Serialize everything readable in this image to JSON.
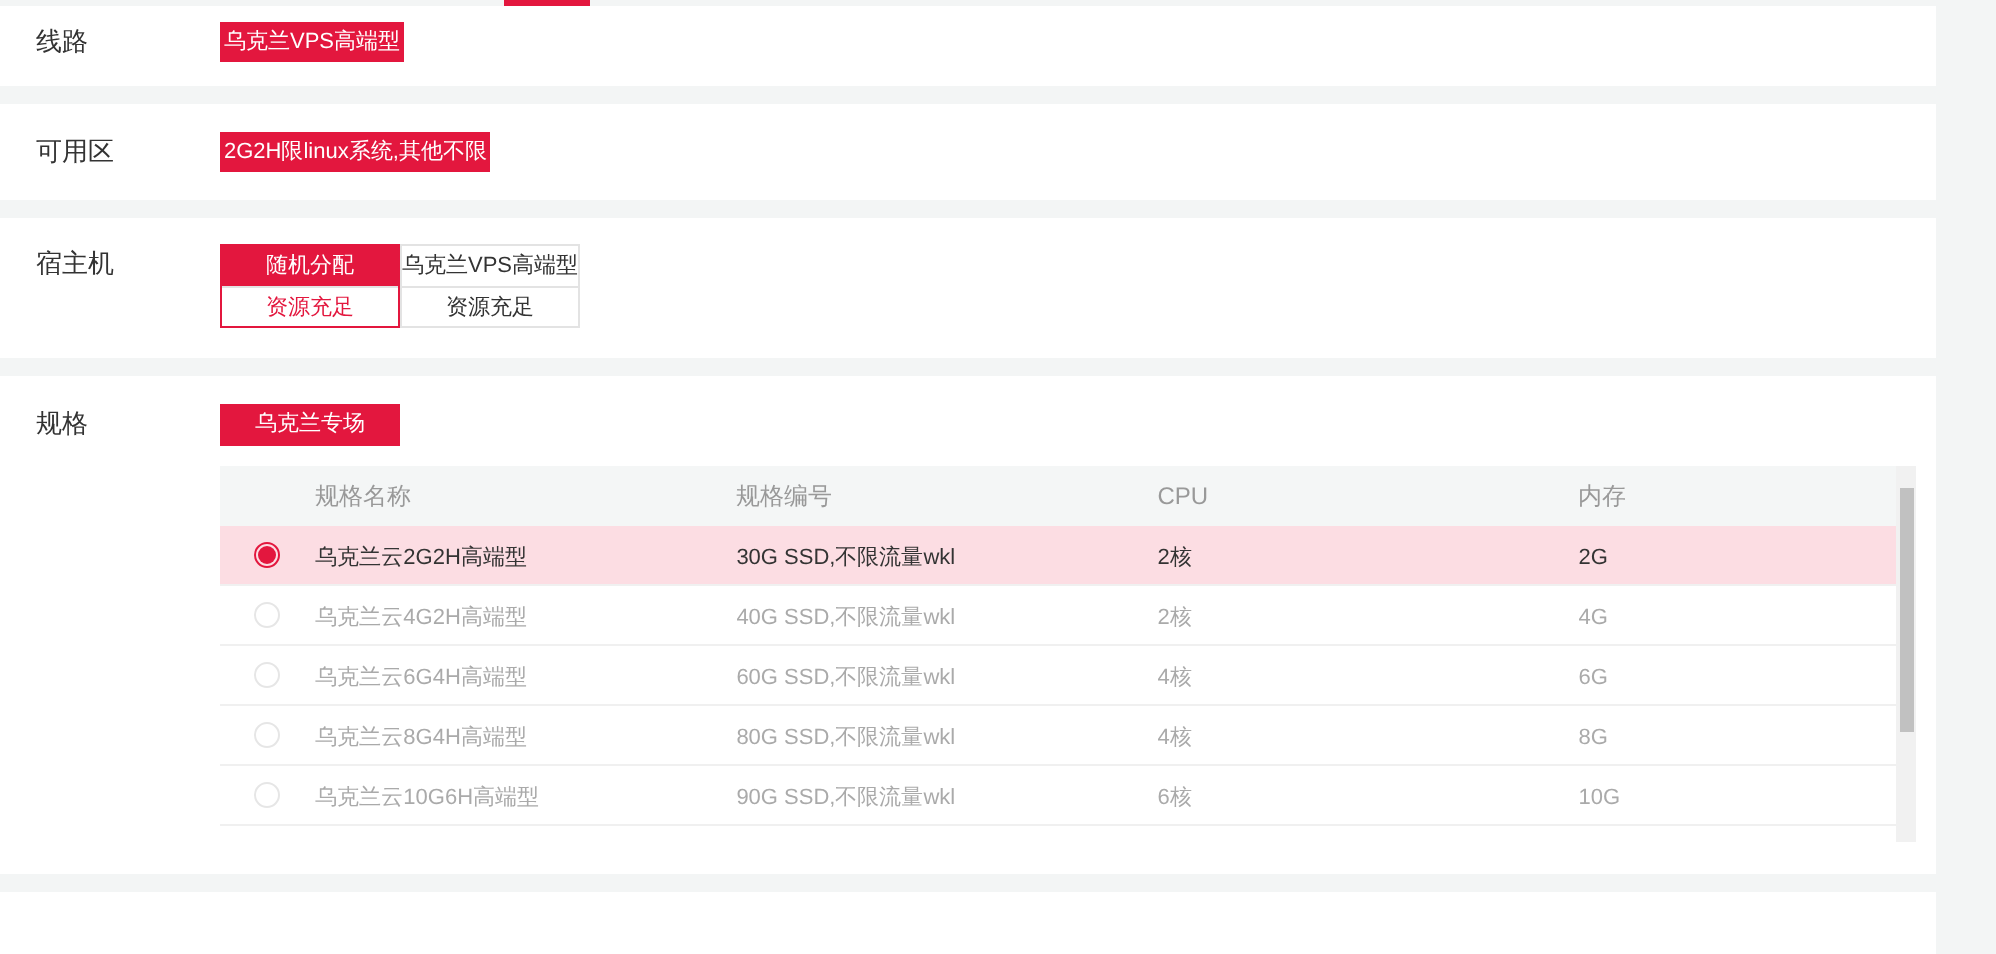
{
  "line": {
    "label": "线路",
    "options": [
      {
        "text": "乌克兰VPS高端型",
        "selected": true
      }
    ]
  },
  "zone": {
    "label": "可用区",
    "options": [
      {
        "text": "2G2H限linux系统,其他不限",
        "selected": true
      }
    ]
  },
  "host": {
    "label": "宿主机",
    "options": [
      {
        "name": "随机分配",
        "status": "资源充足",
        "selected": true
      },
      {
        "name": "乌克兰VPS高端型",
        "status": "资源充足",
        "selected": false
      }
    ]
  },
  "spec": {
    "label": "规格",
    "tabs": [
      {
        "text": "乌克兰专场",
        "selected": true
      }
    ],
    "table": {
      "columns": [
        "规格名称",
        "规格编号",
        "CPU",
        "内存"
      ],
      "rows": [
        {
          "selected": true,
          "cells": [
            "乌克兰云2G2H高端型",
            "30G SSD,不限流量wkl",
            "2核",
            "2G"
          ]
        },
        {
          "selected": false,
          "cells": [
            "乌克兰云4G2H高端型",
            "40G SSD,不限流量wkl",
            "2核",
            "4G"
          ]
        },
        {
          "selected": false,
          "cells": [
            "乌克兰云6G4H高端型",
            "60G SSD,不限流量wkl",
            "4核",
            "6G"
          ]
        },
        {
          "selected": false,
          "cells": [
            "乌克兰云8G4H高端型",
            "80G SSD,不限流量wkl",
            "4核",
            "8G"
          ]
        },
        {
          "selected": false,
          "cells": [
            "乌克兰云10G6H高端型",
            "90G SSD,不限流量wkl",
            "6核",
            "10G"
          ]
        }
      ]
    }
  }
}
